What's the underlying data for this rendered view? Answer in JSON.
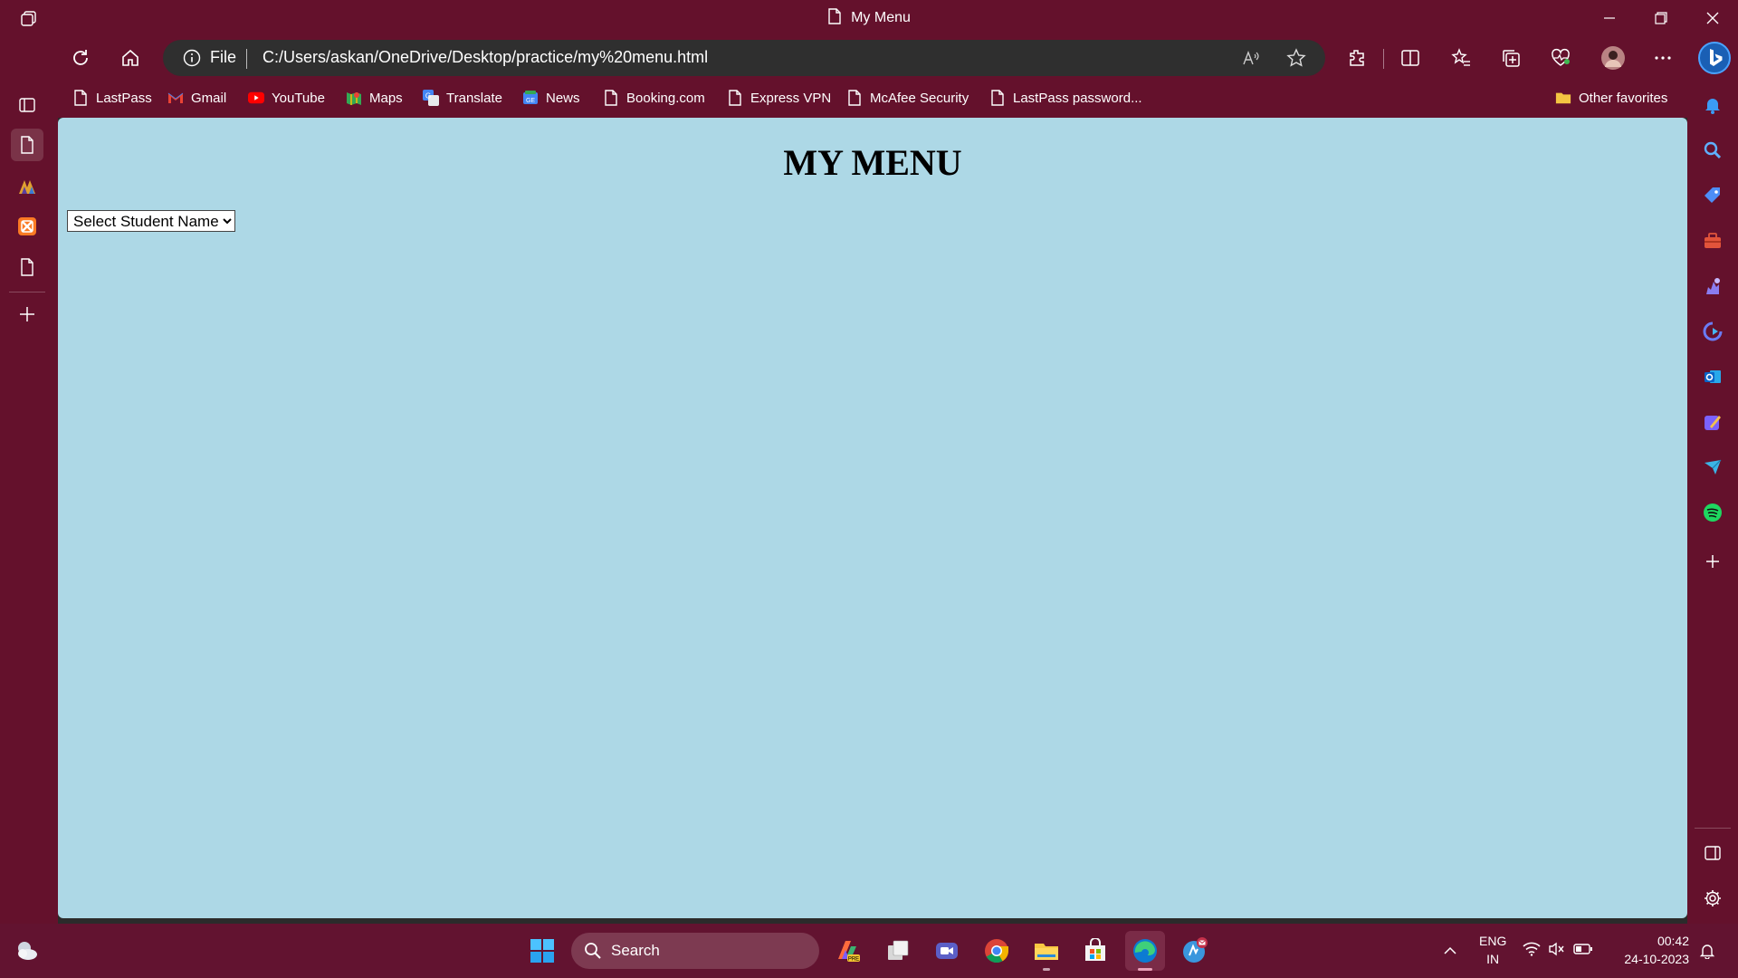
{
  "window": {
    "title": "My Menu"
  },
  "toolbar": {
    "file_label": "File",
    "url": "C:/Users/askan/OneDrive/Desktop/practice/my%20menu.html"
  },
  "favorites": [
    {
      "label": "LastPass",
      "icon": "page-icon"
    },
    {
      "label": "Gmail",
      "icon": "gmail-icon"
    },
    {
      "label": "YouTube",
      "icon": "youtube-icon"
    },
    {
      "label": "Maps",
      "icon": "maps-icon"
    },
    {
      "label": "Translate",
      "icon": "translate-icon"
    },
    {
      "label": "News",
      "icon": "news-icon"
    },
    {
      "label": "Booking.com",
      "icon": "page-icon"
    },
    {
      "label": "Express VPN",
      "icon": "page-icon"
    },
    {
      "label": "McAfee Security",
      "icon": "page-icon"
    },
    {
      "label": "LastPass password...",
      "icon": "page-icon"
    }
  ],
  "other_favorites": "Other favorites",
  "page": {
    "heading": "MY MENU",
    "select": {
      "selected": "Select Student Name",
      "background": "#add8e6"
    }
  },
  "taskbar": {
    "search_label": "Search",
    "lang_line1": "ENG",
    "lang_line2": "IN",
    "time": "00:42",
    "date": "24-10-2023"
  },
  "colors": {
    "chrome": "#64112c",
    "page_bg": "#add8e6",
    "taskbar": "#621330"
  }
}
